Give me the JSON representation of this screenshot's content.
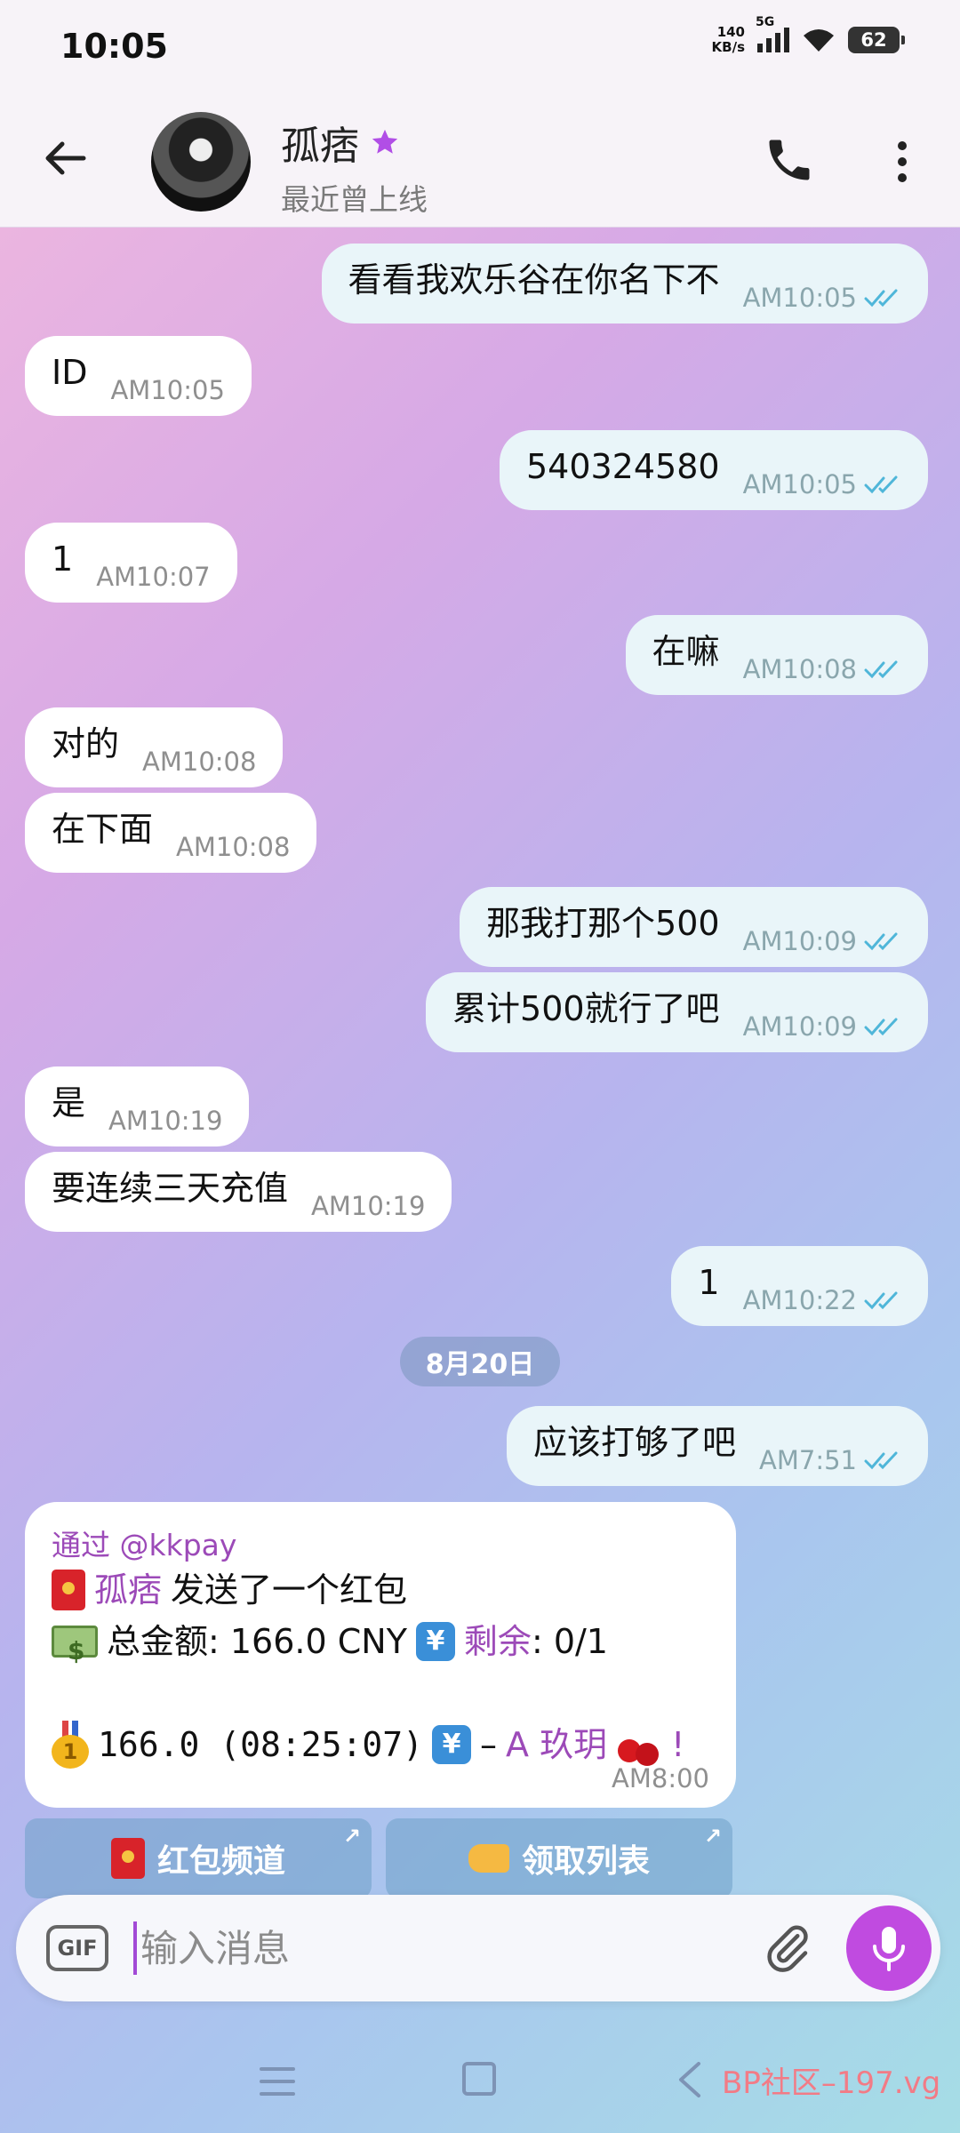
{
  "status_bar": {
    "time": "10:05",
    "net_speed_value": "140",
    "net_speed_unit": "KB/s",
    "network": "5G",
    "battery": "62"
  },
  "header": {
    "name": "孤痞",
    "last_seen": "最近曾上线"
  },
  "messages": [
    {
      "side": "out",
      "text": "看看我欢乐谷在你名下不",
      "time": "AM10:05"
    },
    {
      "side": "in",
      "text": "ID",
      "time": "AM10:05"
    },
    {
      "side": "out",
      "text": "540324580",
      "time": "AM10:05"
    },
    {
      "side": "in",
      "text": "1",
      "time": "AM10:07"
    },
    {
      "side": "out",
      "text": "在嘛",
      "time": "AM10:08"
    },
    {
      "side": "in",
      "text": "对的",
      "time": "AM10:08"
    },
    {
      "side": "in",
      "text": "在下面",
      "time": "AM10:08"
    },
    {
      "side": "out",
      "text": "那我打那个500",
      "time": "AM10:09"
    },
    {
      "side": "out",
      "text": "累计500就行了吧",
      "time": "AM10:09"
    },
    {
      "side": "in",
      "text": "是",
      "time": "AM10:19"
    },
    {
      "side": "in",
      "text": "要连续三天充值",
      "time": "AM10:19"
    },
    {
      "side": "out",
      "text": "1",
      "time": "AM10:22"
    },
    {
      "side": "out",
      "text": "应该打够了吧",
      "time": "AM7:51"
    }
  ],
  "date_separator": "8月20日",
  "red_packet": {
    "via_label": "通过",
    "via_bot": "@kkpay",
    "sender": "孤痞",
    "sent_text": "发送了一个红包",
    "total_label": "总金额: 166.0 CNY",
    "remain_label": "剩余",
    "remain_value": ": 0/1",
    "claim_amount": "166.0 (08:25:07)",
    "claim_dash": "–",
    "claim_user": "A 玖玥",
    "claim_exclaim": "!",
    "time": "AM8:00"
  },
  "keyboard_buttons": [
    {
      "label": "红包频道",
      "icon": "red-envelope-icon"
    },
    {
      "label": "领取列表",
      "icon": "pointing-hand-icon"
    }
  ],
  "input": {
    "gif_label": "GIF",
    "placeholder": "输入消息"
  },
  "watermark": "BP社区–197.vg",
  "colors": {
    "accent": "#c04be0",
    "purple_text": "#9c4ab8",
    "tick": "#4fb6d9"
  }
}
